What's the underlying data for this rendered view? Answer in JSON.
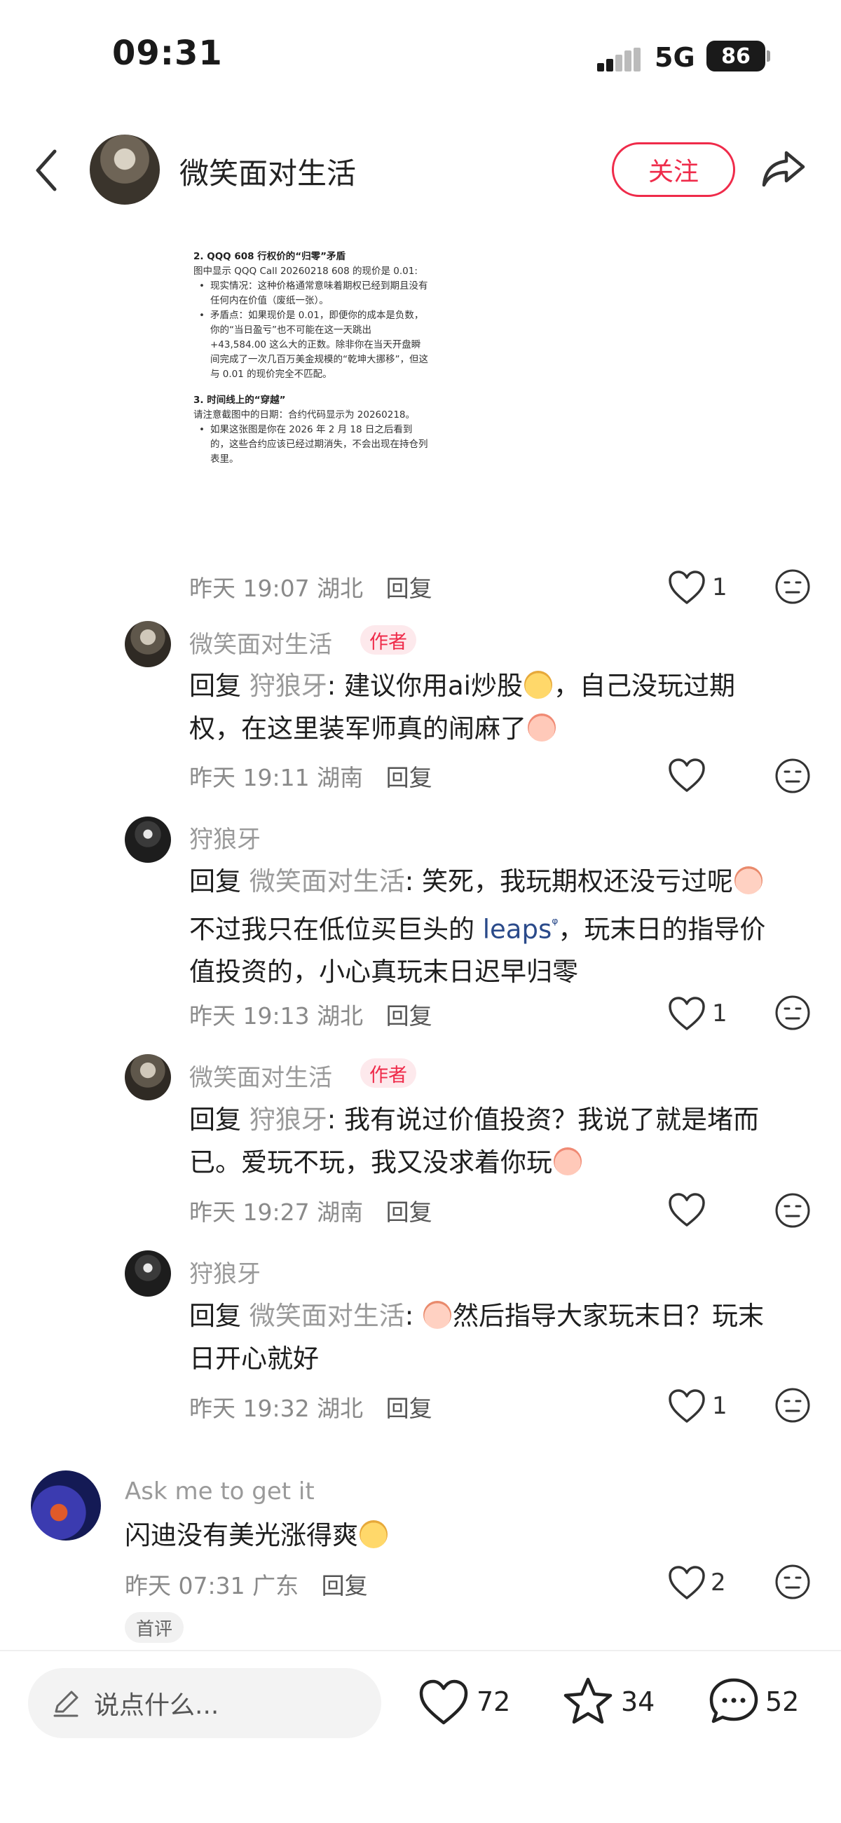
{
  "status": {
    "time": "09:31",
    "network": "5G",
    "battery": "86"
  },
  "header": {
    "username": "微笑面对生活",
    "follow_label": "关注"
  },
  "screenshot": {
    "lines": [
      {
        "kind": "h",
        "text": "2. QQQ 608 行权价的“归零”矛盾"
      },
      {
        "kind": "p",
        "text": "图中显示 QQQ Call 20260218 608 的现价是 0.01:"
      },
      {
        "kind": "b",
        "text": "现实情况：这种价格通常意味着期权已经到期且没有任何内在价值（废纸一张）。"
      },
      {
        "kind": "b",
        "text": "矛盾点：如果现价是 0.01，即便你的成本是负数，你的“当日盈亏”也不可能在这一天跳出 +43,584.00 这么大的正数。除非你在当天开盘瞬间完成了一次几百万美金规模的“乾坤大挪移”，但这与 0.01 的现价完全不匹配。"
      },
      {
        "kind": "h",
        "text": "3. 时间线上的“穿越”"
      },
      {
        "kind": "p",
        "text": "请注意截图中的日期：合约代码显示为 20260218。"
      },
      {
        "kind": "b",
        "text": "如果这张图是你在 2026 年 2 月 18 日之后看到的，这些合约应该已经过期消失，不会出现在持仓列表里。"
      }
    ]
  },
  "comments": [
    {
      "date": "昨天 19:07",
      "location": "湖北",
      "reply": "回复",
      "likes": "1"
    },
    {
      "user": "微笑面对生活",
      "badge": "作者",
      "prefix": "回复 ",
      "mention": "狩狼牙",
      "text1": ": 建议你用ai炒股",
      "text2": "，自己没玩过期",
      "text3": "权，在这里装军师真的闹麻了",
      "emoji1": "laugh-emoji",
      "emoji2": "cry-emoji",
      "date": "昨天 19:11",
      "location": "湖南",
      "reply": "回复",
      "likes": ""
    },
    {
      "user": "狩狼牙",
      "prefix": "回复 ",
      "mention": "微笑面对生活",
      "text1": ": 笑死，我玩期权还没亏过呢",
      "text2": "不过我只在低位买巨头的 ",
      "link": "leaps",
      "text3": "，玩末日的指导价",
      "text4": "值投资的，小心真玩末日迟早归零",
      "emoji1": "smile-emoji",
      "date": "昨天 19:13",
      "location": "湖北",
      "reply": "回复",
      "likes": "1"
    },
    {
      "user": "微笑面对生活",
      "badge": "作者",
      "prefix": "回复 ",
      "mention": "狩狼牙",
      "text1": ": 我有说过价值投资？我说了就是堵而",
      "text2": "已。爱玩不玩，我又没求着你玩",
      "emoji1": "cry-emoji",
      "date": "昨天 19:27",
      "location": "湖南",
      "reply": "回复",
      "likes": ""
    },
    {
      "user": "狩狼牙",
      "prefix": "回复 ",
      "mention": "微笑面对生活",
      "text1": ": ",
      "text2": "然后指导大家玩末日？玩末",
      "text3": "日开心就好",
      "emoji1": "smile-emoji",
      "date": "昨天 19:32",
      "location": "湖北",
      "reply": "回复",
      "likes": "1"
    },
    {
      "user": "Ask me to get it",
      "text1": "闪迪没有美光涨得爽",
      "emoji1": "laugh-emoji",
      "date": "昨天 07:31",
      "location": "广东",
      "reply": "回复",
      "likes": "2",
      "tag": "首评"
    }
  ],
  "bottom": {
    "placeholder": "说点什么...",
    "likes": "72",
    "stars": "34",
    "comments": "52"
  },
  "colors": {
    "accent": "#ef2b4a",
    "muted": "#8a8a8a",
    "link": "#2a4a8a"
  }
}
